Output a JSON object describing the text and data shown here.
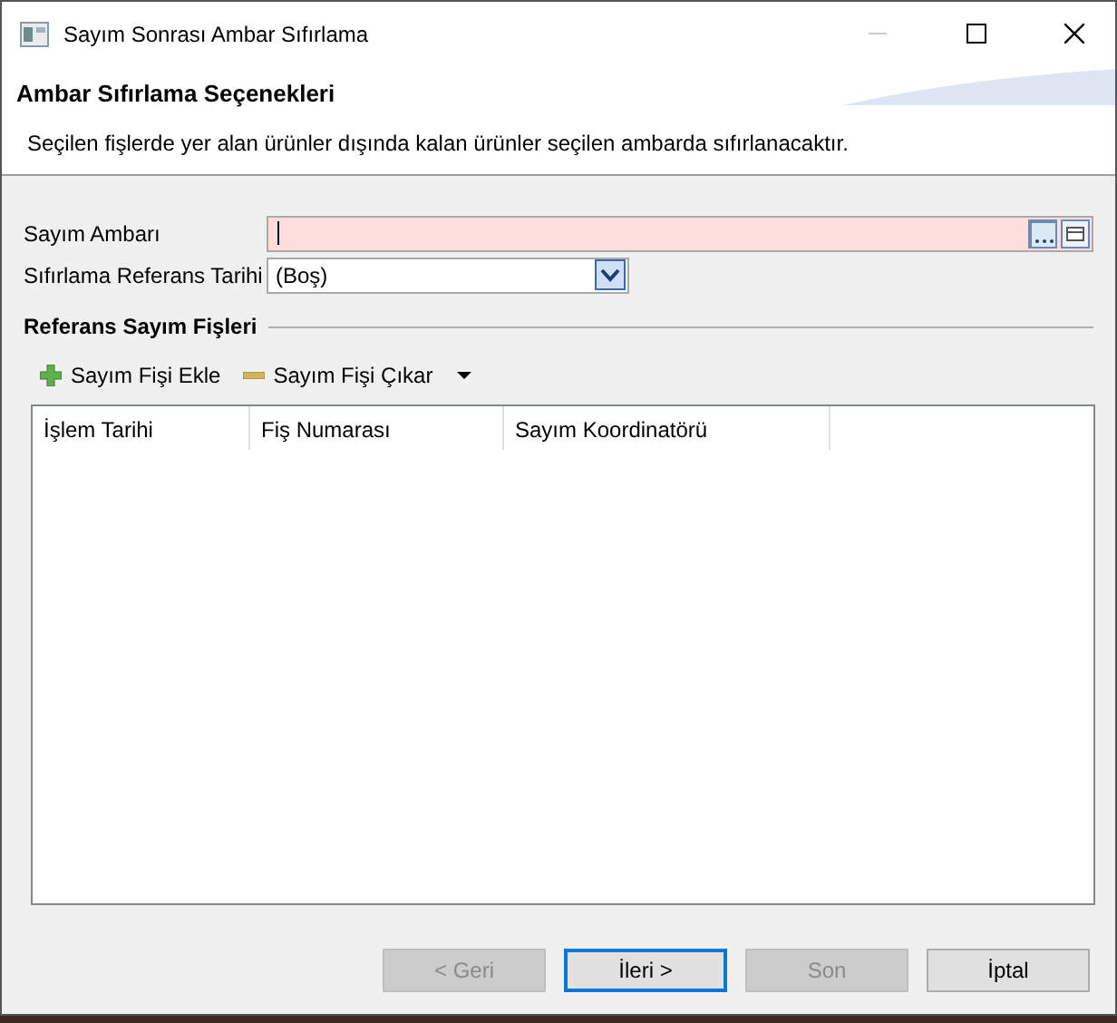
{
  "window": {
    "title": "Sayım Sonrası Ambar Sıfırlama"
  },
  "header": {
    "title": "Ambar Sıfırlama Seçenekleri",
    "description": "Seçilen fişlerde yer alan ürünler dışında kalan ürünler seçilen ambarda sıfırlanacaktır."
  },
  "fields": [
    {
      "label": "Sayım Ambarı",
      "kind": "lookup",
      "invalid": true
    },
    {
      "label": "Sıfırlama Referans Tarihi",
      "kind": "select",
      "value": "(Boş)",
      "invalid": false
    }
  ],
  "group": {
    "title": "Referans Sayım Fişleri",
    "toolbar": [
      {
        "label": "Sayım Fişi Ekle",
        "kind": "add"
      },
      {
        "label": "Sayım Fişi Çıkar",
        "kind": "remove"
      }
    ],
    "table": {
      "columns": [
        "İşlem Tarihi",
        "Fiş Numarası",
        "Sayım Koordinatörü"
      ]
    }
  },
  "buttons": [
    {
      "label": "< Geri",
      "disabled": true,
      "default": false
    },
    {
      "label": "İleri >",
      "disabled": false,
      "default": true
    },
    {
      "label": "Son",
      "disabled": true,
      "default": false
    },
    {
      "label": "İptal",
      "disabled": false,
      "default": false
    }
  ]
}
